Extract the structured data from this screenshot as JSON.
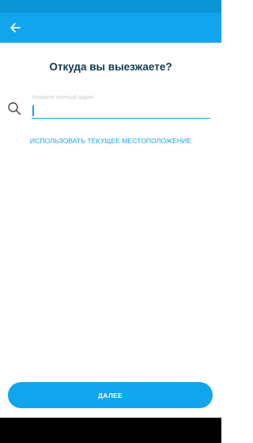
{
  "screen": {
    "title": "Откуда вы выезжаете?"
  },
  "app_bar": {
    "back_icon": "arrow-left-icon"
  },
  "address": {
    "label": "Укажите полный адрес",
    "value": "",
    "search_icon": "search-icon"
  },
  "actions": {
    "use_location_label": "ИСПОЛЬЗОВАТЬ ТЕКУЩЕЕ МЕСТОПОЛОЖЕНИЕ",
    "next_label": "ДАЛЕЕ"
  },
  "colors": {
    "accent": "#11a5ee",
    "status_bar": "#0b95d6",
    "title_text": "#0f3a4a",
    "label_text": "#c4cdd2",
    "nav_bar": "#000000"
  }
}
